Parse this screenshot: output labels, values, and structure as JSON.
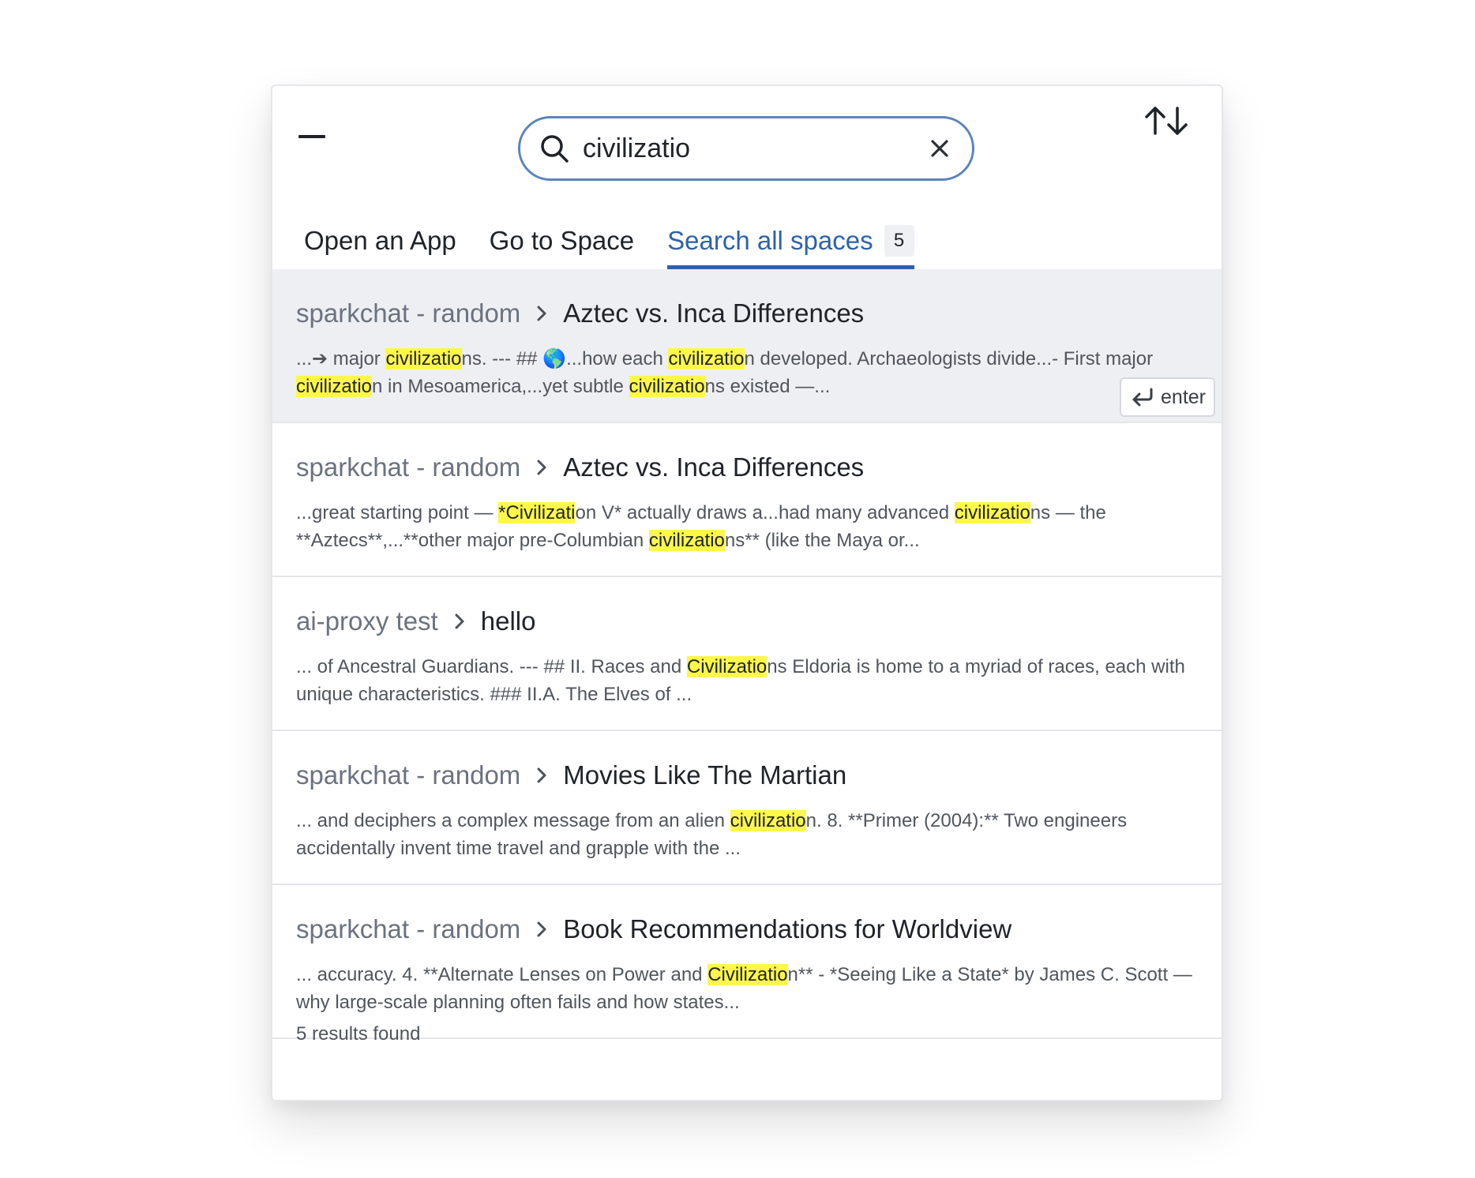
{
  "search": {
    "value": "civilizatio",
    "highlight_color": "#fdf74a",
    "accent_color": "#2e62a8"
  },
  "header": {
    "minimize_icon": "minimize-icon",
    "sort_icon": "sort-arrows-icon",
    "search_icon": "search-icon",
    "clear_icon": "close-icon"
  },
  "tabs": [
    {
      "label": "Open an App"
    },
    {
      "label": "Go to Space"
    },
    {
      "label": "Search all spaces",
      "badge": "5",
      "active": true
    }
  ],
  "results": [
    {
      "space": "sparkchat - random",
      "title": "Aztec vs. Inca Differences",
      "selected": true,
      "snippet": [
        {
          "t": "...➔ major "
        },
        {
          "t": "civilizatio",
          "hl": true
        },
        {
          "t": "ns. --- ## 🌎...how each "
        },
        {
          "t": "civilizatio",
          "hl": true
        },
        {
          "t": "n developed. Archaeologists divide...- First major "
        },
        {
          "t": "civilizatio",
          "hl": true
        },
        {
          "t": "n in Mesoamerica,...yet subtle "
        },
        {
          "t": "civilizatio",
          "hl": true
        },
        {
          "t": "ns existed —..."
        }
      ]
    },
    {
      "space": "sparkchat - random",
      "title": "Aztec vs. Inca Differences",
      "snippet": [
        {
          "t": "...great starting point — "
        },
        {
          "t": "*Civilizati",
          "hl": true
        },
        {
          "t": "on V* actually draws a...had many advanced "
        },
        {
          "t": "civilizatio",
          "hl": true
        },
        {
          "t": "ns — the **Aztecs**,...**other major pre-Columbian "
        },
        {
          "t": "civilizatio",
          "hl": true
        },
        {
          "t": "ns** (like the Maya or..."
        }
      ]
    },
    {
      "space": "ai-proxy test",
      "title": "hello",
      "snippet": [
        {
          "t": "... of Ancestral Guardians. --- ## II. Races and "
        },
        {
          "t": "Civilizatio",
          "hl": true
        },
        {
          "t": "ns Eldoria is home to a myriad of races, each with unique characteristics. ### II.A. The Elves of ..."
        }
      ]
    },
    {
      "space": "sparkchat - random",
      "title": "Movies Like The Martian",
      "snippet": [
        {
          "t": "... and deciphers a complex message from an alien "
        },
        {
          "t": "civilizatio",
          "hl": true
        },
        {
          "t": "n. 8. **Primer (2004):** Two engineers accidentally invent time travel and grapple with the ..."
        }
      ]
    },
    {
      "space": "sparkchat - random",
      "title": "Book Recommendations for Worldview",
      "snippet": [
        {
          "t": "... accuracy. 4. **Alternate Lenses on Power and "
        },
        {
          "t": "Civilizatio",
          "hl": true
        },
        {
          "t": "n** - *Seeing Like a State* by James C. Scott — why large-scale planning often fails and how states..."
        }
      ]
    }
  ],
  "enter_hint": {
    "label": "enter",
    "icon": "return-icon"
  },
  "footer": {
    "status": "5 results found"
  }
}
